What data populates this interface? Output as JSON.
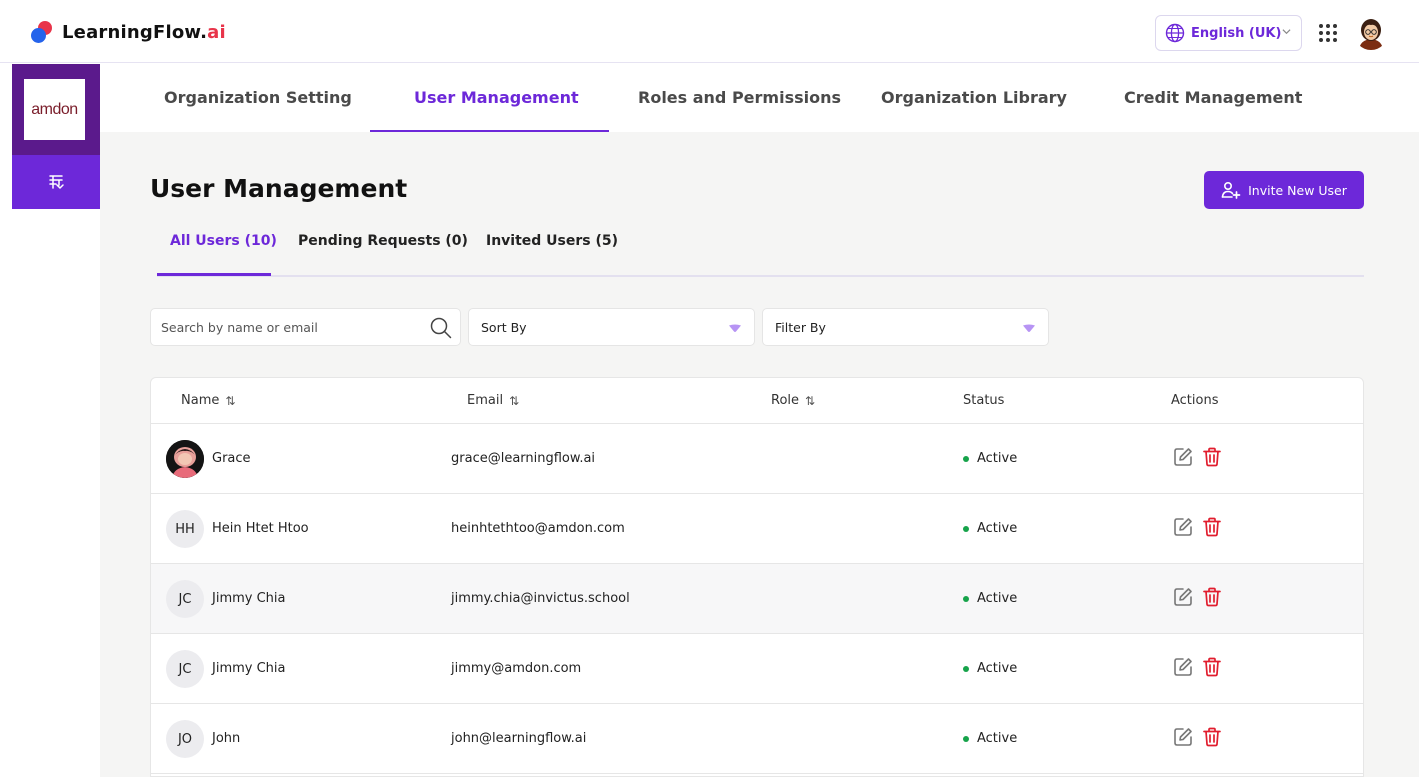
{
  "brand": {
    "name": "LearningFlow.",
    "suffix": "ai"
  },
  "header": {
    "language": "English (UK)"
  },
  "org": {
    "logo_text": "amdon"
  },
  "nav": {
    "tabs": [
      {
        "label": "Organization Setting"
      },
      {
        "label": "User Management"
      },
      {
        "label": "Roles and Permissions"
      },
      {
        "label": "Organization Library"
      },
      {
        "label": "Credit Management"
      }
    ],
    "active_index": 1
  },
  "page": {
    "title": "User Management",
    "invite_label": "Invite New User"
  },
  "subtabs": [
    {
      "label": "All Users (10)"
    },
    {
      "label": "Pending Requests (0)"
    },
    {
      "label": "Invited Users (5)"
    }
  ],
  "filters": {
    "search_placeholder": "Search by name or email",
    "sort_label": "Sort By",
    "filter_label": "Filter By"
  },
  "table": {
    "columns": [
      {
        "label": "Name",
        "sort": "⇅"
      },
      {
        "label": "Email",
        "sort": "⇅"
      },
      {
        "label": "Role",
        "sort": "⇅"
      },
      {
        "label": "Status"
      },
      {
        "label": "Actions"
      }
    ],
    "rows": [
      {
        "initials": "",
        "photo": true,
        "name": "Grace",
        "email": "grace@learningflow.ai",
        "role": "",
        "status": "Active"
      },
      {
        "initials": "HH",
        "photo": false,
        "name": "Hein Htet Htoo",
        "email": "heinhtethtoo@amdon.com",
        "role": "",
        "status": "Active"
      },
      {
        "initials": "JC",
        "photo": false,
        "name": "Jimmy Chia",
        "email": "jimmy.chia@invictus.school",
        "role": "",
        "status": "Active"
      },
      {
        "initials": "JC",
        "photo": false,
        "name": "Jimmy Chia",
        "email": "jimmy@amdon.com",
        "role": "",
        "status": "Active"
      },
      {
        "initials": "JO",
        "photo": false,
        "name": "John",
        "email": "john@learningflow.ai",
        "role": "",
        "status": "Active"
      }
    ]
  },
  "colors": {
    "primary": "#6d28d9",
    "rail": "#5b1a8c",
    "active_status": "#16a34a",
    "delete": "#e11d2e",
    "brand_red": "#e8344a",
    "brand_blue": "#2563eb"
  }
}
